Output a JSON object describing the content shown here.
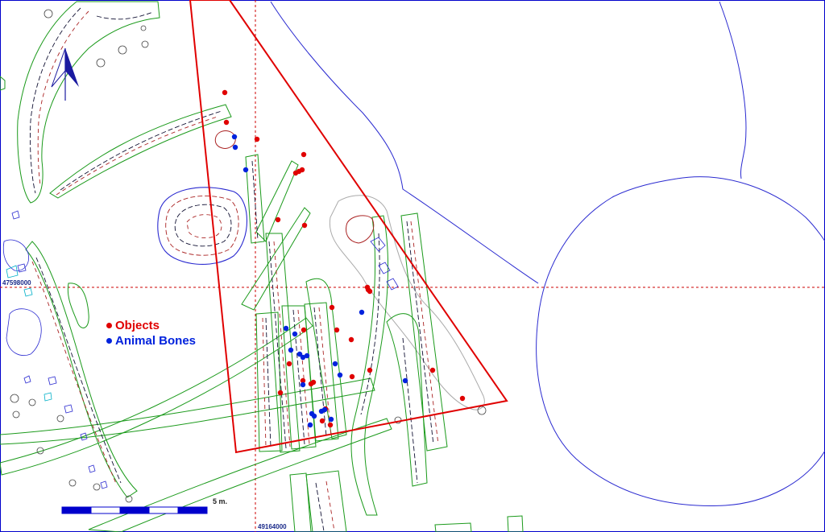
{
  "map": {
    "coordinate_labels": {
      "horizontal": "47598000",
      "vertical": "49164000"
    },
    "scale_label": "5 m.",
    "colors": {
      "frame": "#0000cc",
      "grid": "#cc0000",
      "triangle": "#e00000",
      "objects": "#e00000",
      "animal_bones": "#0022dd",
      "wood_outline": "#1b9a1b",
      "feature_outline": "#2a2ad0",
      "hatch_red": "#aa2222",
      "hatch_dark": "#111133",
      "gray_zone": "#aaaaaa"
    },
    "north_arrow_icon": "north-arrow-icon"
  },
  "legend": {
    "items": [
      {
        "label": "Objects",
        "color": "#e00000"
      },
      {
        "label": "Animal Bones",
        "color": "#0022dd"
      }
    ]
  }
}
